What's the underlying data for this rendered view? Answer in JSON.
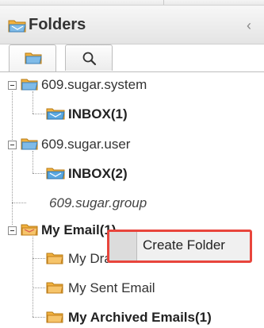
{
  "header": {
    "title": "Folders",
    "collapse_glyph": "‹"
  },
  "tabs": [
    {
      "icon": "folder-icon",
      "selected": true
    },
    {
      "icon": "search-icon",
      "selected": false
    }
  ],
  "tree": {
    "nodes": [
      {
        "label": "609.sugar.system",
        "icon": "folder-icon",
        "style": "normal"
      },
      {
        "label": "INBOX(1)",
        "icon": "inbox-folder-icon",
        "style": "bold"
      },
      {
        "label": "609.sugar.user",
        "icon": "folder-icon",
        "style": "normal"
      },
      {
        "label": "INBOX(2)",
        "icon": "inbox-folder-icon",
        "style": "bold"
      },
      {
        "label": "609.sugar.group",
        "icon": "",
        "style": "italic"
      },
      {
        "label": "My Email(1)",
        "icon": "folder-icon",
        "style": "bold"
      },
      {
        "label": "My Drafts",
        "icon": "folder-icon",
        "style": "normal"
      },
      {
        "label": "My Sent Email",
        "icon": "folder-icon",
        "style": "normal"
      },
      {
        "label": "My Archived Emails(1)",
        "icon": "folder-icon",
        "style": "bold"
      }
    ]
  },
  "context_menu": {
    "item_label": "Create Folder",
    "highlight_color": "#e8453c"
  },
  "colors": {
    "folder": "#f2b13d",
    "inbox_tint": "#5aa8e0"
  }
}
